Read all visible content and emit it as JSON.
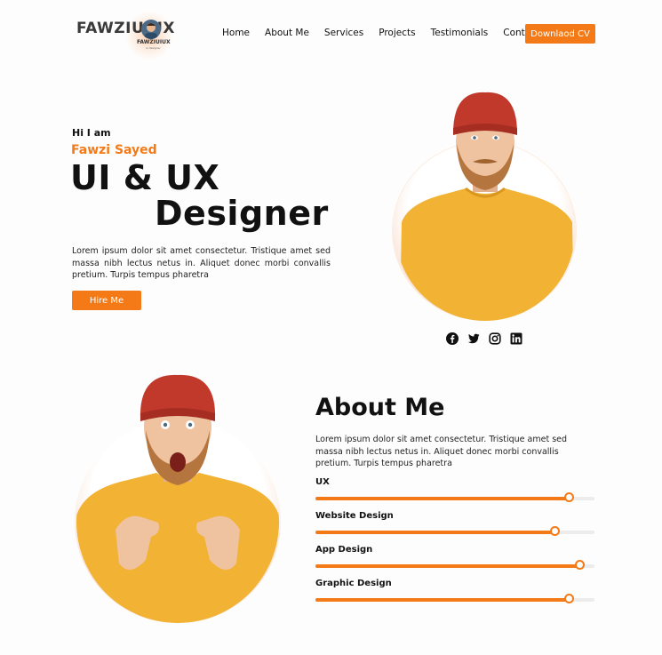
{
  "brand": {
    "logo_text": "FAWZIUIUX",
    "logo_sub": "FAWZIUIUX",
    "logo_sub2": "ui designer"
  },
  "nav": {
    "items": [
      "Home",
      "About Me",
      "Services",
      "Projects",
      "Testimonials",
      "Contact"
    ],
    "cta_label": "Downlaod CV"
  },
  "hero": {
    "greeting": "Hi I am",
    "name": "Fawzi Sayed",
    "title_line1": "UI & UX",
    "title_line2": "Designer",
    "description": "Lorem ipsum dolor sit amet consectetur. Tristique amet sed massa nibh lectus netus in. Aliquet donec morbi convallis pretium. Turpis tempus pharetra",
    "button_label": "Hire Me",
    "socials": [
      "facebook-icon",
      "twitter-icon",
      "instagram-icon",
      "linkedin-icon"
    ]
  },
  "about": {
    "title": "About Me",
    "description": "Lorem ipsum dolor sit amet consectetur. Tristique amet sed massa nibh lectus netus in. Aliquet donec morbi convallis pretium. Turpis tempus pharetra",
    "skills": [
      {
        "label": "UX",
        "level": 0.91
      },
      {
        "label": "Website Design",
        "level": 0.86
      },
      {
        "label": "App Design",
        "level": 0.95
      },
      {
        "label": "Graphic Design",
        "level": 0.91
      }
    ]
  },
  "colors": {
    "accent": "#f47a17",
    "sweater": "#f2b233",
    "beanie": "#c0392b"
  }
}
